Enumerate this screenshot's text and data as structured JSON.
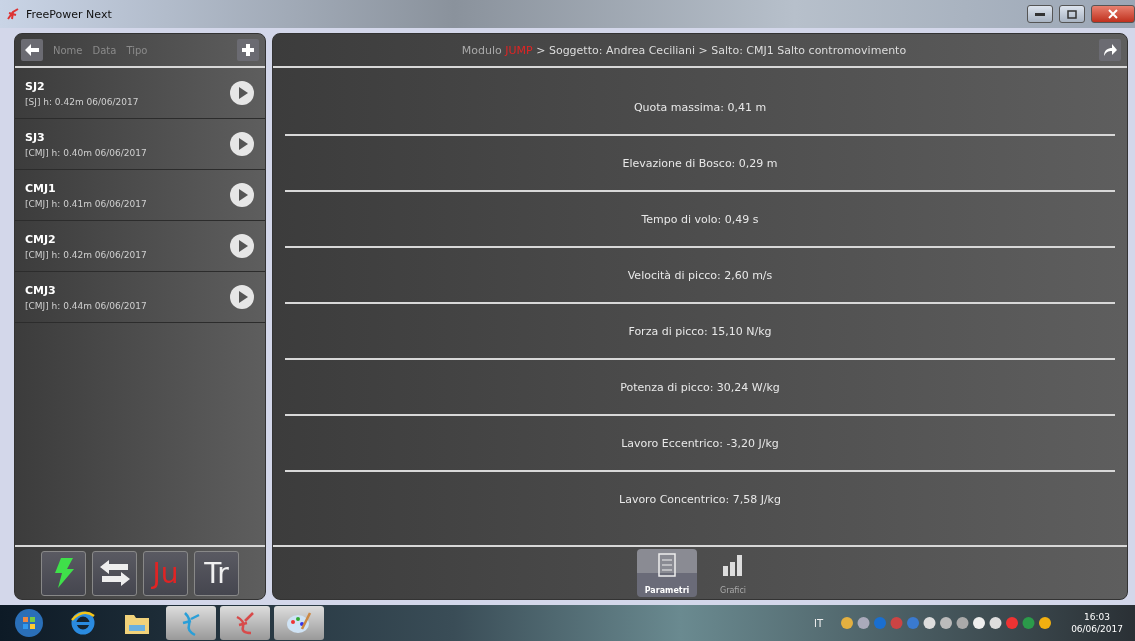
{
  "window": {
    "title": "FreePower Next"
  },
  "sidebar": {
    "sort_labels": [
      "Nome",
      "Data",
      "Tipo"
    ],
    "items": [
      {
        "name": "SJ2",
        "detail": "[SJ] h: 0.42m 06/06/2017"
      },
      {
        "name": "SJ3",
        "detail": "[CMJ] h: 0.40m 06/06/2017"
      },
      {
        "name": "CMJ1",
        "detail": "[CMJ] h: 0.41m 06/06/2017"
      },
      {
        "name": "CMJ2",
        "detail": "[CMJ] h: 0.42m 06/06/2017"
      },
      {
        "name": "CMJ3",
        "detail": "[CMJ] h: 0.44m 06/06/2017"
      }
    ],
    "tools": [
      {
        "kind": "bolt"
      },
      {
        "kind": "swap"
      },
      {
        "kind": "text",
        "label": "Ju",
        "color": "#e02424"
      },
      {
        "kind": "text",
        "label": "Tr",
        "color": "#f0f0f0"
      }
    ]
  },
  "breadcrumb": {
    "prefix": "Modulo",
    "module": "JUMP",
    "path": "> Soggetto: Andrea Ceciliani > Salto: CMJ1 Salto contromovimento"
  },
  "parameters": [
    "Quota massima: 0,41 m",
    "Elevazione di Bosco: 0,29 m",
    "Tempo di volo: 0,49 s",
    "Velocità di picco: 2,60 m/s",
    "Forza di picco: 15,10 N/kg",
    "Potenza di picco: 30,24 W/kg",
    "Lavoro Eccentrico: -3,20 J/kg",
    "Lavoro Concentrico: 7,58 J/kg"
  ],
  "tabs": [
    {
      "label": "Parametri",
      "kind": "list",
      "selected": true
    },
    {
      "label": "Grafici",
      "kind": "chart",
      "selected": false
    }
  ],
  "taskbar": {
    "language": "IT",
    "time": "16:03",
    "date": "06/06/2017"
  }
}
